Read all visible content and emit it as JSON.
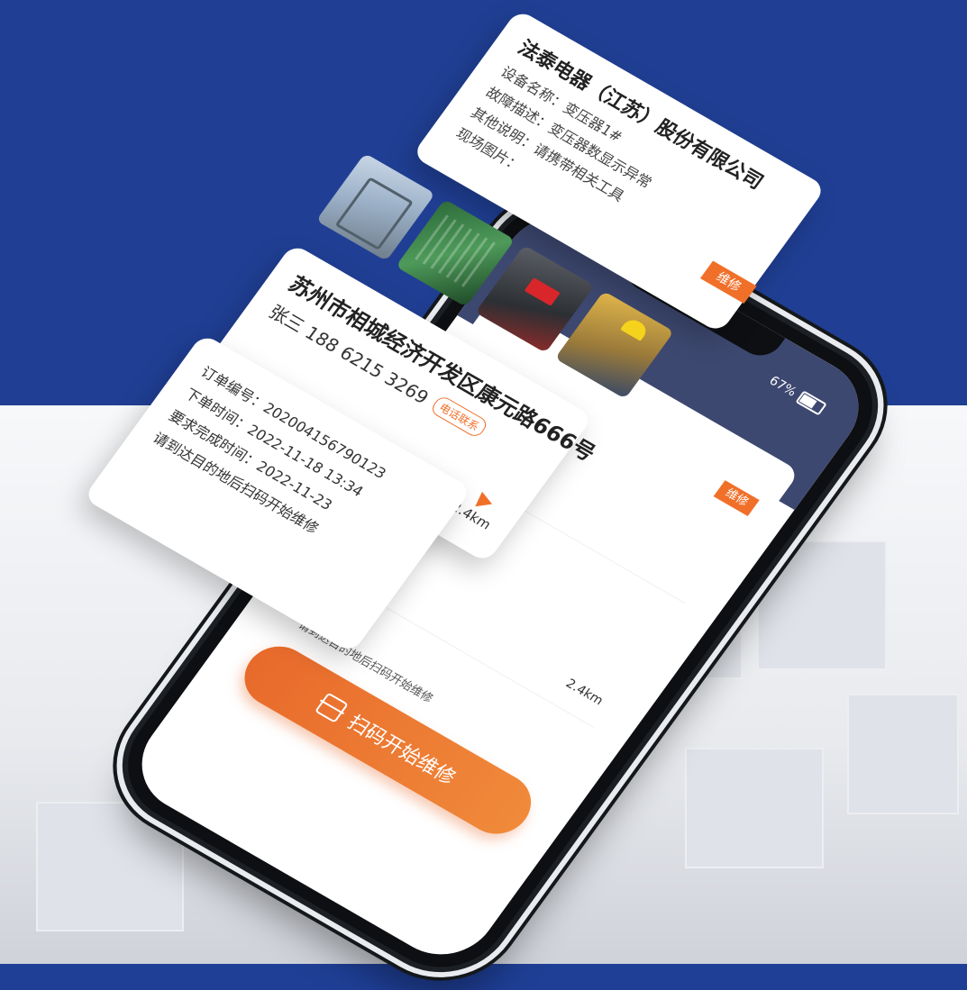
{
  "status_bar": {
    "battery": "67%"
  },
  "card_device": {
    "company": "法泰电器（江苏）股份有限公司",
    "device_name": "设备名称：变压器1#",
    "fault_desc": "故障描述：变压器数显示异常",
    "other_note": "其他说明：请携带相关工具",
    "photos_label": "现场图片：",
    "tag": "维修"
  },
  "card_address": {
    "address": "苏州市相城经济开发区康元路666号",
    "contact": "张三 188 6215 3269",
    "call_label": "电话联系",
    "distance": "2.4km"
  },
  "card_order": {
    "order_no": "订单编号：20200415679012З",
    "order_time": "下单时间：2022-11-18  13:34",
    "deadline": "要求完成时间：2022-11-23",
    "hint": "请到达目的地后扫码开始维修"
  },
  "screen": {
    "list_tag": "维修",
    "hint": "请到达目的地后扫码开始维修",
    "distance": "2.4km",
    "scan_button": "扫码开始维修"
  },
  "icons": {
    "battery": "battery-icon",
    "navigate": "navigation-arrow-icon",
    "scan": "scan-icon"
  },
  "colors": {
    "brand_blue": "#203f94",
    "accent_orange": "#f0702a"
  }
}
